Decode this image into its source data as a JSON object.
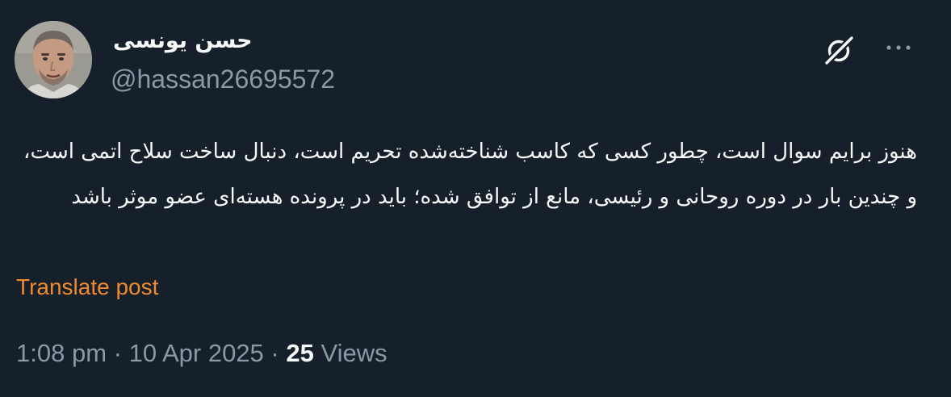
{
  "author": {
    "display_name": "حسن یونسی",
    "handle": "@hassan26695572"
  },
  "icons": {
    "grok": "grok-slash-circle-icon",
    "more": "more-dots-icon"
  },
  "post": {
    "text": "هنوز برایم سوال است، چطور کسی که کاسب شناخته‌شده تحریم است، دنبال ساخت سلاح اتمی است، و چندین بار در دوره روحانی و رئیسی، مانع از توافق شده؛ باید در پرونده هسته‌ای عضو موثر باشد",
    "translate_label": "Translate post"
  },
  "meta": {
    "time": "1:08 pm",
    "separator": "·",
    "date": "10 Apr 2025",
    "views_count": "25",
    "views_label": "Views"
  },
  "colors": {
    "background": "#15202b",
    "text_primary": "#f7f9f9",
    "text_secondary": "#8b98a5",
    "translate_link": "#f08a2e"
  }
}
